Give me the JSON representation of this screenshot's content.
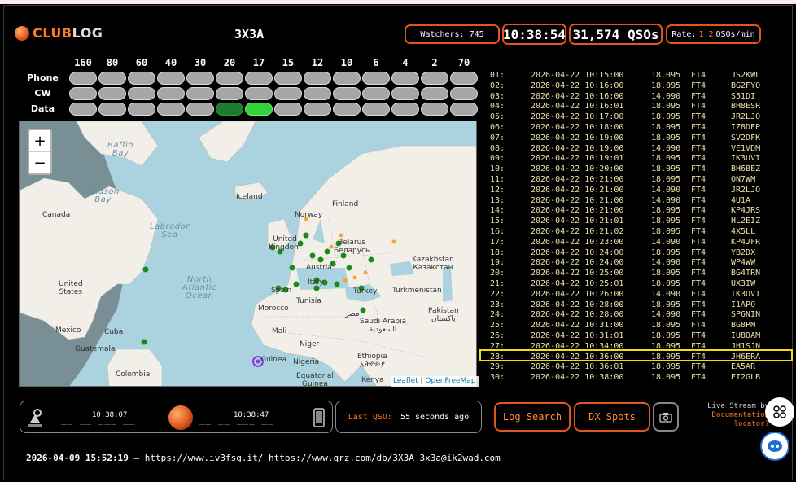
{
  "header": {
    "logo_club": "CLUB",
    "logo_log": "LOG",
    "callsign": "3X3A",
    "watchers": "Watchers: 745",
    "clock": "10:38:54",
    "qsos": "31,574 QSOs",
    "rate_prefix": "Rate:",
    "rate_value": "1.2",
    "rate_suffix": "QSOs/min"
  },
  "bands": [
    "160",
    "80",
    "60",
    "40",
    "30",
    "20",
    "17",
    "15",
    "12",
    "10",
    "6",
    "4",
    "2",
    "70"
  ],
  "modes": [
    "Phone",
    "CW",
    "Data"
  ],
  "active_cells": [
    {
      "mode": "Data",
      "band": "20",
      "status": "previous",
      "color": "#1e7a2c"
    },
    {
      "mode": "Data",
      "band": "17",
      "status": "current",
      "color": "#33d23a"
    }
  ],
  "map": {
    "zoom_in": "+",
    "zoom_out": "−",
    "attribution_leaflet": "Leaflet",
    "attribution_sep": " | ",
    "attribution_osm": "OpenFreeMap",
    "labels": {
      "baffin_bay": "Baffin\nBay",
      "hudson_bay": "Hudson\nBay",
      "labrador_sea": "Labrador\nSea",
      "north_atlantic": "North\nAtlantic\nOcean",
      "iceland": "Iceland",
      "finland": "Finland",
      "norway": "Norway",
      "canada": "Canada",
      "united_kingdom": "United\nKingdom",
      "belarus": "Belarus\nБеларусь",
      "kazakhstan": "Kazakhstan\nҚазақстан",
      "austria": "Austria",
      "italy": "Italy",
      "spain": "Spain",
      "turkey": "Turkey",
      "turkmenistan": "Turkmenistan",
      "united_states": "United\nStates",
      "morocco": "Morocco",
      "tunisia": "Tunisia",
      "egypt": "مصر",
      "saudi_arabia": "Saudi Arabia\nالسعودية",
      "pakistan": "Pakistan\nپاکستان",
      "mexico": "Mexico",
      "cuba": "Cuba",
      "guatemala": "Guatemala",
      "mali": "Mali",
      "niger": "Niger",
      "nigeria": "Nigeria",
      "guinea": "Guinea",
      "ethiopia": "Ethiopia\nኢትዮጵያ",
      "colombia": "Colombia",
      "equatorial_guinea": "Equatorial\nGuinea",
      "kenya": "Kenya"
    }
  },
  "qso_log": [
    {
      "n": "01:",
      "dt": "2026-04-22 10:15:00",
      "freq": "18.095",
      "mode": "FT4",
      "call": "JS2KWL"
    },
    {
      "n": "02:",
      "dt": "2026-04-22 10:16:00",
      "freq": "18.095",
      "mode": "FT4",
      "call": "BG2FYO"
    },
    {
      "n": "03:",
      "dt": "2026-04-22 10:16:00",
      "freq": "14.090",
      "mode": "FT4",
      "call": "S51DI"
    },
    {
      "n": "04:",
      "dt": "2026-04-22 10:16:01",
      "freq": "18.095",
      "mode": "FT4",
      "call": "BH8ESR"
    },
    {
      "n": "05:",
      "dt": "2026-04-22 10:17:00",
      "freq": "18.095",
      "mode": "FT4",
      "call": "JR2LJO"
    },
    {
      "n": "06:",
      "dt": "2026-04-22 10:18:00",
      "freq": "18.095",
      "mode": "FT4",
      "call": "IZ8DEP"
    },
    {
      "n": "07:",
      "dt": "2026-04-22 10:19:00",
      "freq": "18.095",
      "mode": "FT4",
      "call": "SV2DFK"
    },
    {
      "n": "08:",
      "dt": "2026-04-22 10:19:00",
      "freq": "14.090",
      "mode": "FT4",
      "call": "VE1VDM"
    },
    {
      "n": "09:",
      "dt": "2026-04-22 10:19:01",
      "freq": "18.095",
      "mode": "FT4",
      "call": "IK3UVI"
    },
    {
      "n": "10:",
      "dt": "2026-04-22 10:20:00",
      "freq": "18.095",
      "mode": "FT4",
      "call": "BH6BEZ"
    },
    {
      "n": "11:",
      "dt": "2026-04-22 10:21:00",
      "freq": "18.095",
      "mode": "FT4",
      "call": "ON7WM"
    },
    {
      "n": "12:",
      "dt": "2026-04-22 10:21:00",
      "freq": "14.090",
      "mode": "FT4",
      "call": "JR2LJO"
    },
    {
      "n": "13:",
      "dt": "2026-04-22 10:21:00",
      "freq": "14.090",
      "mode": "FT4",
      "call": "4U1A"
    },
    {
      "n": "14:",
      "dt": "2026-04-22 10:21:00",
      "freq": "18.095",
      "mode": "FT4",
      "call": "KP4JRS"
    },
    {
      "n": "15:",
      "dt": "2026-04-22 10:21:01",
      "freq": "18.095",
      "mode": "FT4",
      "call": "HL2EIZ"
    },
    {
      "n": "16:",
      "dt": "2026-04-22 10:21:02",
      "freq": "18.095",
      "mode": "FT4",
      "call": "4X5LL"
    },
    {
      "n": "17:",
      "dt": "2026-04-22 10:23:00",
      "freq": "14.090",
      "mode": "FT4",
      "call": "KP4JFR"
    },
    {
      "n": "18:",
      "dt": "2026-04-22 10:24:00",
      "freq": "18.095",
      "mode": "FT4",
      "call": "YB2DX"
    },
    {
      "n": "19:",
      "dt": "2026-04-22 10:24:00",
      "freq": "14.090",
      "mode": "FT4",
      "call": "WP4WW"
    },
    {
      "n": "20:",
      "dt": "2026-04-22 10:25:00",
      "freq": "18.095",
      "mode": "FT4",
      "call": "BG4TRN"
    },
    {
      "n": "21:",
      "dt": "2026-04-22 10:25:01",
      "freq": "18.095",
      "mode": "FT4",
      "call": "UX3IW"
    },
    {
      "n": "22:",
      "dt": "2026-04-22 10:26:00",
      "freq": "14.090",
      "mode": "FT4",
      "call": "IK3UVI"
    },
    {
      "n": "23:",
      "dt": "2026-04-22 10:28:00",
      "freq": "18.095",
      "mode": "FT4",
      "call": "I1APQ"
    },
    {
      "n": "24:",
      "dt": "2026-04-22 10:28:00",
      "freq": "14.090",
      "mode": "FT4",
      "call": "SP6NIN"
    },
    {
      "n": "25:",
      "dt": "2026-04-22 10:31:00",
      "freq": "18.095",
      "mode": "FT4",
      "call": "BG8PM"
    },
    {
      "n": "26:",
      "dt": "2026-04-22 10:31:01",
      "freq": "18.095",
      "mode": "FT4",
      "call": "IU8DAM"
    },
    {
      "n": "27:",
      "dt": "2026-04-22 10:34:00",
      "freq": "18.095",
      "mode": "FT4",
      "call": "JH1SJN"
    },
    {
      "n": "28:",
      "dt": "2026-04-22 10:36:00",
      "freq": "18.095",
      "mode": "FT4",
      "call": "JH6ERA"
    },
    {
      "n": "29:",
      "dt": "2026-04-22 10:36:01",
      "freq": "18.095",
      "mode": "FT4",
      "call": "EA5AR"
    },
    {
      "n": "30:",
      "dt": "2026-04-22 10:38:00",
      "freq": "18.095",
      "mode": "FT4",
      "call": "EI2GLB"
    }
  ],
  "highlighted_row": "28:",
  "stream": {
    "time_left": "10:38:07",
    "time_right": "10:38:47",
    "dashes_left": "__ __ ___ __",
    "dashes_right": "__ __ ___ __"
  },
  "last_qso": {
    "label": "Last QSO:",
    "value": "55 seconds ago"
  },
  "buttons": {
    "log_search": "Log Search",
    "dx_spots": "DX Spots",
    "camera_icon": "camera-icon"
  },
  "live_stream": {
    "line1": "Live Stream by ",
    "line2": "Documentation",
    "line3": "locator?"
  },
  "footer": {
    "timestamp": "2026-04-09 15:52:19",
    "text": "— https://www.iv3fsg.it/ https://www.qrz.com/db/3X3A 3x3a@ik2wad.com"
  },
  "colors": {
    "accent": "#e0561c",
    "log_text": "#e9e0a8",
    "highlight": "#f2e000",
    "cell_idle": "#a6a6a6"
  }
}
